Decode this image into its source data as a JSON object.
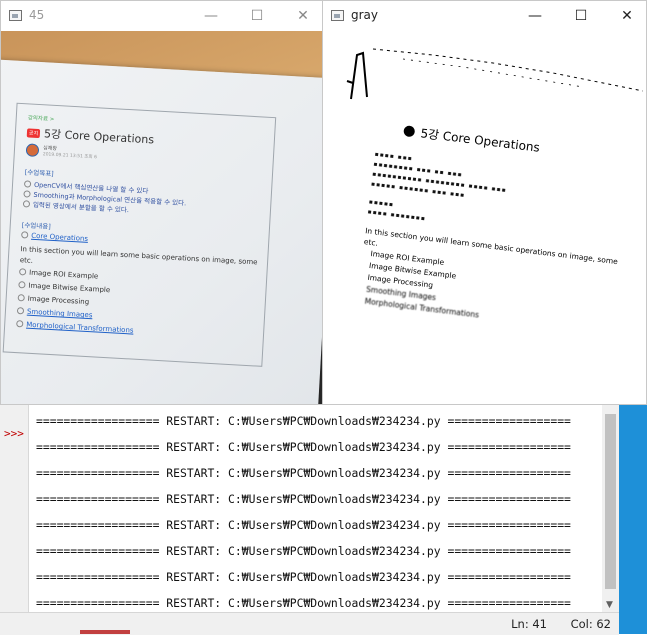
{
  "window_45": {
    "title": "45",
    "document": {
      "breadcrumb": "강의자료 >",
      "badge": "공지",
      "lecture_title": "5강 Core Operations",
      "author_name": "심재창",
      "author_meta": "2019.09.21 13:51  조회 6",
      "objectives_header": "[수업목표]",
      "objectives": [
        "OpenCV에서 핵심연산을 나열 할 수 있다",
        "Smoothing과 Morphological 연산을 적용할 수 있다.",
        "입력된 영상에서 분할을 할 수 있다."
      ],
      "contents_header": "[수업내용]",
      "core_link": "Core Operations",
      "intro": "In this section you will learn some basic operations on image, some etc.",
      "items": [
        "Image ROI Example",
        "Image Bitwise Example",
        "Image Processing"
      ],
      "links": [
        "Smoothing Images",
        "Morphological Transformations"
      ]
    }
  },
  "window_gray": {
    "title": "gray",
    "document": {
      "lecture_title": "5강 Core Operations",
      "intro": "In this section you will learn some basic operations on image, some etc.",
      "items": [
        "Image ROI Example",
        "Image Bitwise Example",
        "Image Processing",
        "Smoothing Images",
        "Morphological Transformations"
      ]
    }
  },
  "window_controls": {
    "minimize": "—",
    "maximize": "☐",
    "close": "✕"
  },
  "shell": {
    "prompt": ">>>",
    "lines": [
      "================== RESTART: C:₩Users₩PC₩Downloads₩234234.py ==================",
      "================== RESTART: C:₩Users₩PC₩Downloads₩234234.py ==================",
      "================== RESTART: C:₩Users₩PC₩Downloads₩234234.py ==================",
      "================== RESTART: C:₩Users₩PC₩Downloads₩234234.py ==================",
      "================== RESTART: C:₩Users₩PC₩Downloads₩234234.py ==================",
      "================== RESTART: C:₩Users₩PC₩Downloads₩234234.py ==================",
      "================== RESTART: C:₩Users₩PC₩Downloads₩234234.py ==================",
      "================== RESTART: C:₩Users₩PC₩Downloads₩234234.py =================="
    ],
    "status": {
      "ln": "Ln: 41",
      "col": "Col: 62"
    }
  },
  "colors": {
    "accent_blue": "#1e90d8",
    "prompt_red": "#c00000"
  }
}
